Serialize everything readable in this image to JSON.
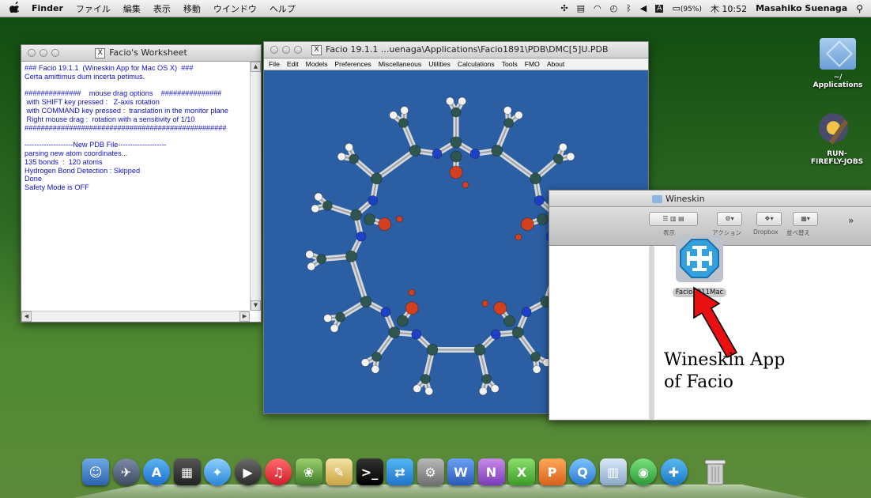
{
  "menubar": {
    "apple": "",
    "app": "Finder",
    "items": [
      "ファイル",
      "編集",
      "表示",
      "移動",
      "ウインドウ",
      "ヘルプ"
    ],
    "battery": "(95%)",
    "clock": "木 10:52",
    "user": "Masahiko Suenaga"
  },
  "worksheet": {
    "title": "Facio's Worksheet",
    "lines": [
      "### Facio 19.1.1  (Wineskin App for Mac OS X)  ###",
      "Certa amittimus dum incerta petimus.",
      "",
      "##############    mouse drag options    ###############",
      " with SHIFT key pressed :   Z-axis rotation",
      " with COMMAND key pressed :  translation in the monitor plane",
      " Right mouse drag :  rotation with a sensitivity of 1/10",
      "##################################################",
      "",
      "--------------------New PDB File--------------------",
      "parsing new atom coordinates...",
      "135 bonds  :  120 atoms",
      "Hydrogen Bond Detection : Skipped",
      "Done",
      "Safety Mode is OFF"
    ]
  },
  "facio": {
    "title": "Facio 19.1.1      ...uenaga\\Applications\\Facio1891\\PDB\\DMC[5]U.PDB",
    "menu": [
      "File",
      "Edit",
      "Models",
      "Preferences",
      "Miscellaneous",
      "Utilities",
      "Calculations",
      "Tools",
      "FMO",
      "About"
    ]
  },
  "finder": {
    "title": "Wineskin",
    "toolbar_labels": [
      "表示",
      "アクション",
      "Dropbox",
      "並べ替え"
    ],
    "chevron": "»",
    "file_label": "Facio1911Mac"
  },
  "desktop": {
    "icons": [
      {
        "label": "~/\nApplications",
        "icon": "folder-icon"
      },
      {
        "label": "RUN-\nFIREFLY-JOBS",
        "icon": "gear-app-icon"
      }
    ]
  },
  "annotation": {
    "text": "Wineskin App\nof Facio",
    "arrow_color": "#e81010"
  },
  "colors": {
    "viewport": "#2b5ea3",
    "carbon": "#2f5550",
    "nitrogen": "#1e3fc7",
    "oxygen": "#d2401f",
    "hydrogen": "#f4f4f4"
  }
}
